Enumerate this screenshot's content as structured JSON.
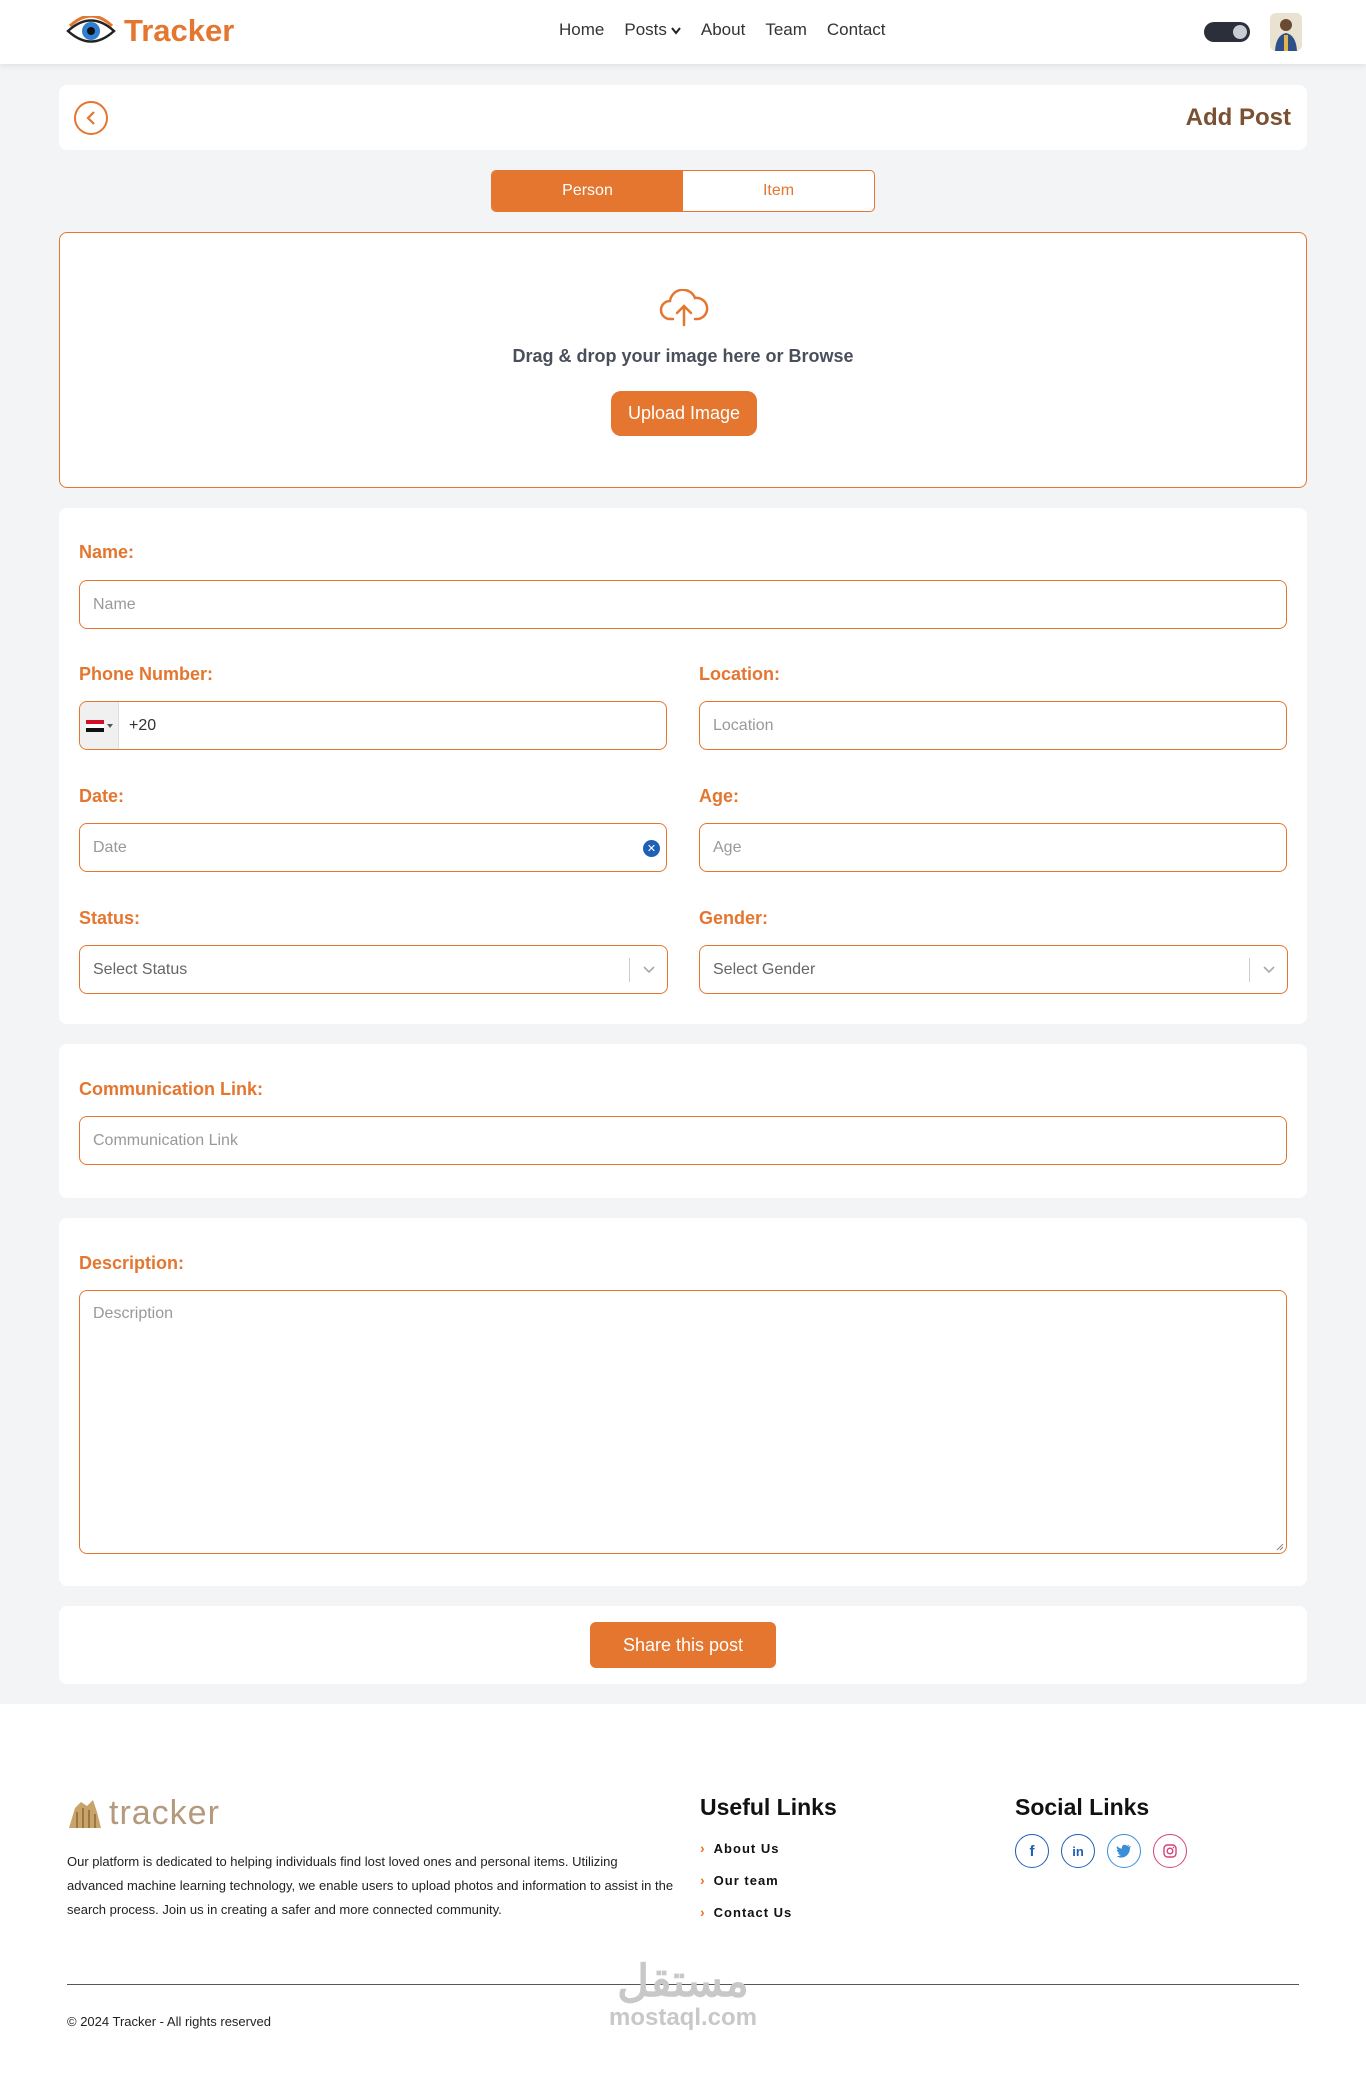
{
  "navbar": {
    "brand": "Tracker",
    "links": {
      "home": "Home",
      "posts": "Posts",
      "about": "About",
      "team": "Team",
      "contact": "Contact"
    }
  },
  "header": {
    "title": "Add Post"
  },
  "post_type": {
    "person": "Person",
    "item": "Item",
    "selected": "Person"
  },
  "upload": {
    "text": "Drag & drop your image here or Browse",
    "button": "Upload Image"
  },
  "form": {
    "name_label": "Name:",
    "name_placeholder": "Name",
    "phone_label": "Phone Number:",
    "phone_value": "+20",
    "location_label": "Location:",
    "location_placeholder": "Location",
    "date_label": "Date:",
    "date_placeholder": "Date",
    "age_label": "Age:",
    "age_placeholder": "Age",
    "status_label": "Status:",
    "status_placeholder": "Select Status",
    "gender_label": "Gender:",
    "gender_placeholder": "Select Gender"
  },
  "communication": {
    "label": "Communication Link:",
    "placeholder": "Communication Link"
  },
  "description": {
    "label": "Description:",
    "placeholder": "Description"
  },
  "share": {
    "button": "Share this post"
  },
  "footer": {
    "logo": "tracker",
    "about": "Our platform is dedicated to helping individuals find lost loved ones and personal items. Utilizing advanced machine learning technology, we enable users to upload photos and information to assist in the search process. Join us in creating a safer and more connected community.",
    "useful_heading": "Useful Links",
    "useful_links": [
      "About Us",
      "Our team",
      "Contact Us"
    ],
    "social_heading": "Social Links",
    "social_icons": [
      "facebook-icon",
      "linkedin-icon",
      "twitter-icon",
      "instagram-icon"
    ],
    "copyright": "© 2024 Tracker - All rights reserved",
    "watermark_ar": "مستقل",
    "watermark_en": "mostaql.com"
  },
  "colors": {
    "accent": "#e4762f",
    "title_brown": "#7b5134",
    "background": "#f3f4f6"
  }
}
